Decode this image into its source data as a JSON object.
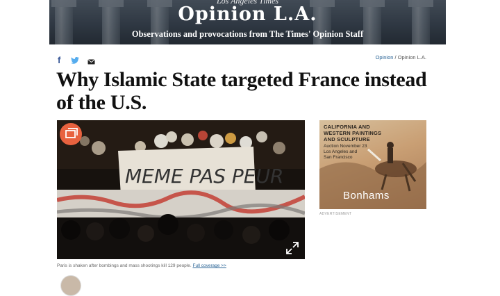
{
  "banner": {
    "masthead": "Los Angeles Times",
    "blog_title": "Opinion L.A.",
    "tagline": "Observations and provocations from The Times' Opinion Staff"
  },
  "share": {
    "facebook": "f",
    "twitter_icon": "twitter-bird-icon",
    "email_icon": "envelope-icon"
  },
  "breadcrumb": {
    "section": "Opinion",
    "separator": " / ",
    "subsection": "Opinion L.A."
  },
  "article": {
    "headline": "Why Islamic State targeted France instead of the U.S.",
    "photo": {
      "banner_text": "MEME PAS PEUR",
      "caption": "Paris is shaken after bombings and mass shootings kill 129 people.",
      "caption_link": "Full coverage >>"
    }
  },
  "ad": {
    "title_lines": [
      "CALIFORNIA AND",
      "WESTERN PAINTINGS",
      "AND SCULPTURE"
    ],
    "detail_lines": [
      "Auction November 23",
      "Los Angeles and",
      "San Francisco"
    ],
    "brand": "Bonhams",
    "label": "ADVERTISEMENT"
  },
  "colors": {
    "accent_orange": "#e8623f",
    "link_blue": "#2a6496",
    "facebook_blue": "#3b5998",
    "twitter_blue": "#55acee"
  }
}
